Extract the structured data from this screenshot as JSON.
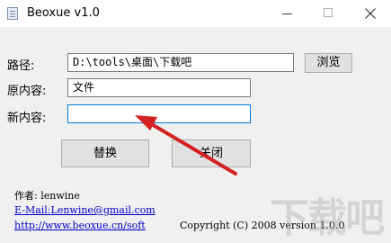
{
  "window": {
    "title": "Beoxue v1.0"
  },
  "form": {
    "path_label": "路径:",
    "path_value": "D:\\tools\\桌面\\下载吧",
    "browse_label": "浏览",
    "original_label": "原内容:",
    "original_value": "文件",
    "new_label": "新内容:",
    "new_value": ""
  },
  "actions": {
    "replace_label": "替换",
    "close_label": "关闭"
  },
  "footer": {
    "author": "作者: lenwine",
    "email": "E-Mail:Lenwine@gmail.com",
    "url": "http://www.beoxue.cn/soft",
    "copyright": "Copyright (C) 2008 version 1.0.0"
  },
  "colors": {
    "arrow": "#d42222",
    "link": "#0000cc",
    "focus_border": "#0078d7"
  },
  "icons": [
    "app-icon",
    "minimize-icon",
    "maximize-icon",
    "close-icon",
    "red-arrow-annotation"
  ]
}
